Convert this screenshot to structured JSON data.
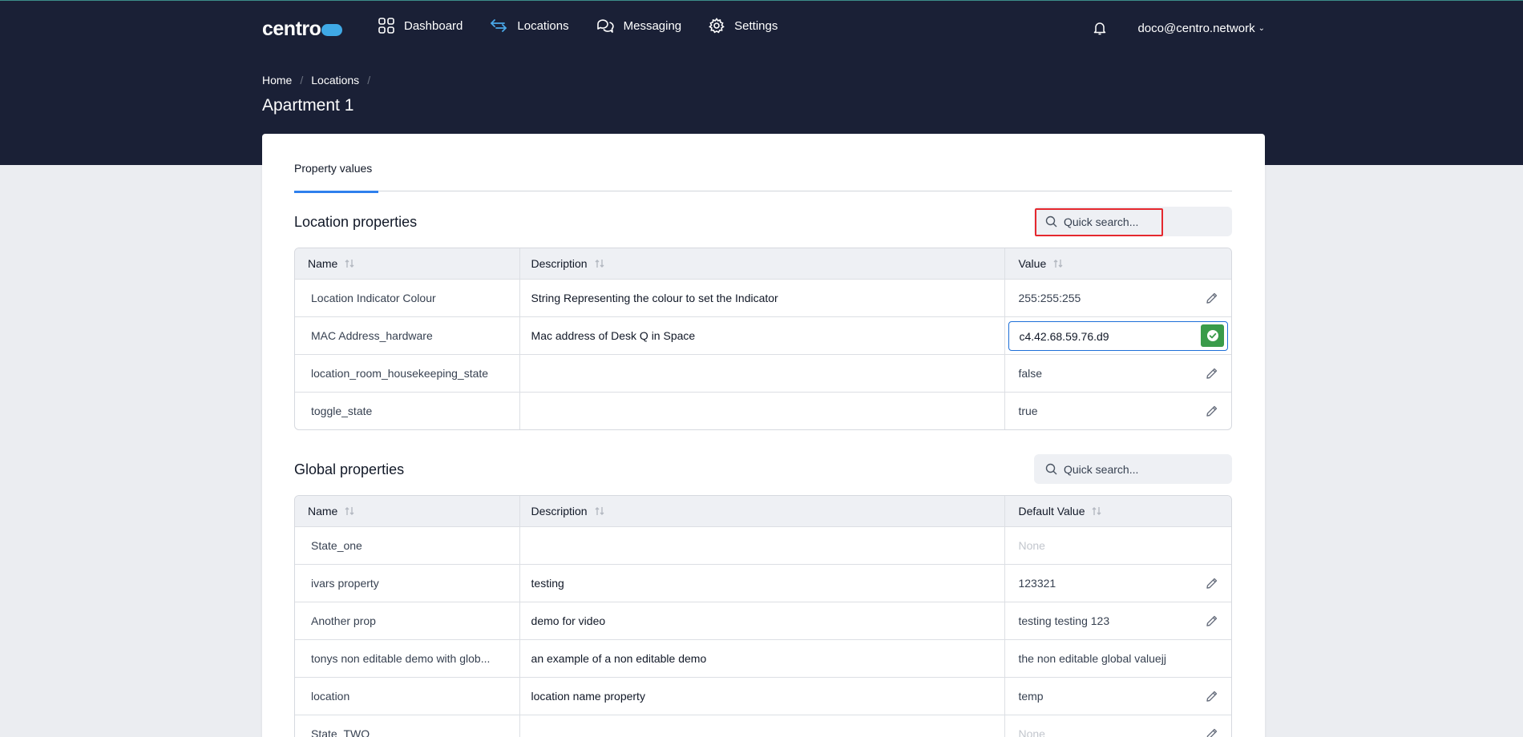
{
  "app": {
    "logo": "centro"
  },
  "nav": [
    {
      "label": "Dashboard",
      "icon": "grid-icon"
    },
    {
      "label": "Locations",
      "icon": "arrows-icon"
    },
    {
      "label": "Messaging",
      "icon": "chat-icon"
    },
    {
      "label": "Settings",
      "icon": "gear-icon"
    }
  ],
  "user": {
    "email": "doco@centro.network"
  },
  "breadcrumb": [
    "Home",
    "Locations"
  ],
  "page_title": "Apartment 1",
  "tabs": [
    "Property values"
  ],
  "location_properties": {
    "title": "Location properties",
    "search_placeholder": "Quick search...",
    "columns": [
      "Name",
      "Description",
      "Value"
    ],
    "rows": [
      {
        "name": "Location Indicator Colour",
        "description": "String Representing the colour to set the Indicator",
        "value": "255:255:255"
      },
      {
        "name": "MAC Address_hardware",
        "description": "Mac address of Desk Q in Space",
        "value": "c4.42.68.59.76.d9"
      },
      {
        "name": "location_room_housekeeping_state",
        "description": "",
        "value": "false"
      },
      {
        "name": "toggle_state",
        "description": "",
        "value": "true"
      }
    ]
  },
  "global_properties": {
    "title": "Global properties",
    "search_placeholder": "Quick search...",
    "columns": [
      "Name",
      "Description",
      "Default Value"
    ],
    "rows": [
      {
        "name": "State_one",
        "description": "",
        "value": "None"
      },
      {
        "name": "ivars property",
        "description": "testing",
        "value": "123321"
      },
      {
        "name": "Another prop",
        "description": "demo for video",
        "value": "testing testing 123"
      },
      {
        "name": "tonys non editable demo with glob...",
        "description": "an example of a non editable demo",
        "value": "the non editable global valuejj"
      },
      {
        "name": "location",
        "description": "location name property",
        "value": "temp"
      },
      {
        "name": "State_TWO",
        "description": "",
        "value": "None"
      }
    ]
  },
  "colors": {
    "header_bg": "#1a2036",
    "accent": "#2f80ed",
    "confirm": "#3a9b4a",
    "highlight": "#e5282e"
  }
}
